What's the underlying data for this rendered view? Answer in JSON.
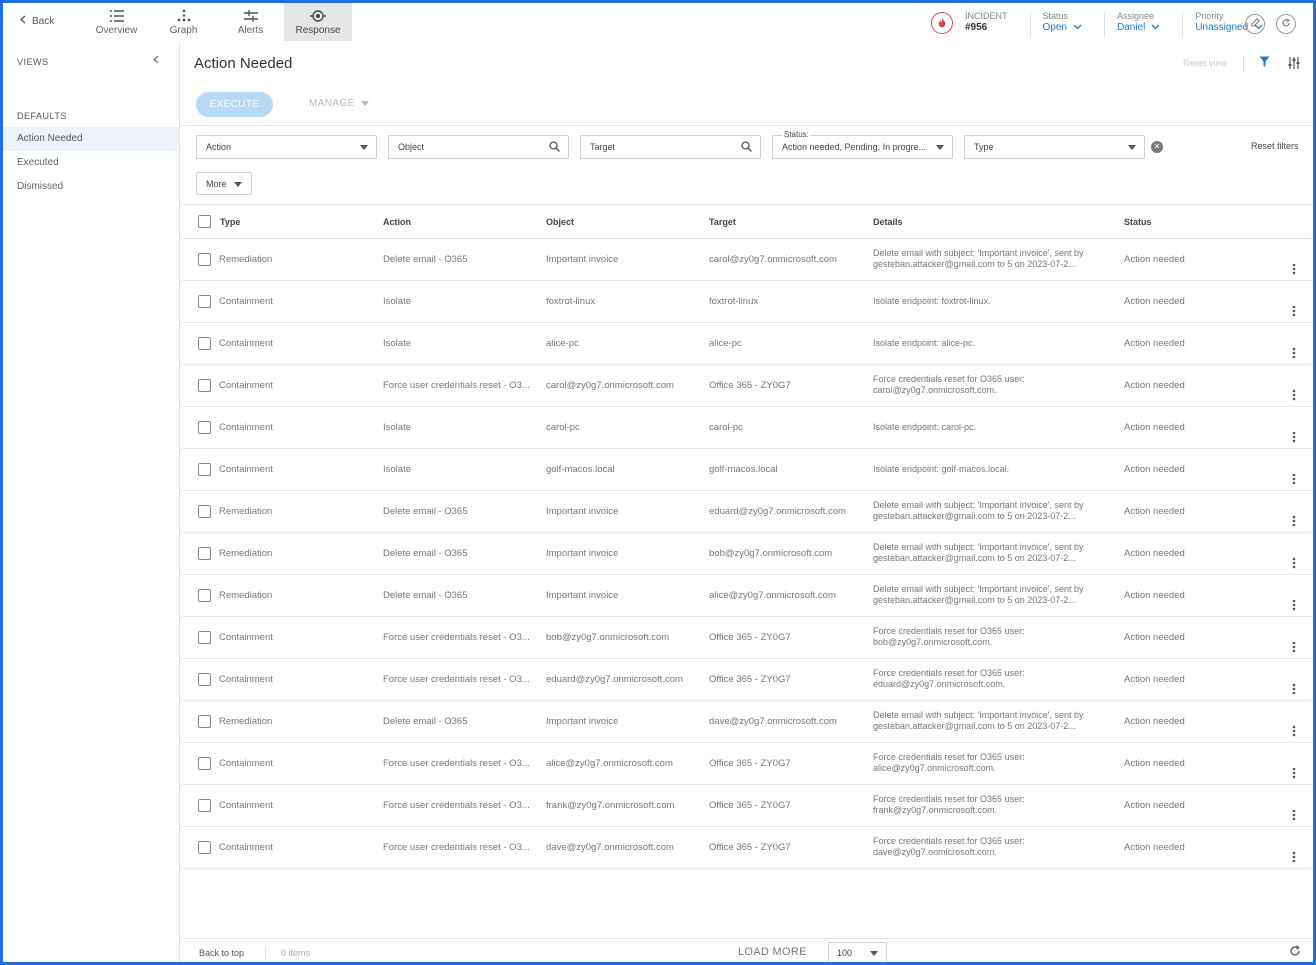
{
  "topbar": {
    "back_label": "Back",
    "tabs": [
      {
        "label": "Overview",
        "icon": "list-icon"
      },
      {
        "label": "Graph",
        "icon": "graph-icon"
      },
      {
        "label": "Alerts",
        "icon": "alerts-icon"
      },
      {
        "label": "Response",
        "icon": "response-icon"
      }
    ],
    "incident_label": "INCIDENT",
    "incident_id": "#956",
    "status_label": "Status",
    "status_value": "Open",
    "assignee_label": "Assignee",
    "assignee_value": "Daniel",
    "priority_label": "Priority",
    "priority_value": "Unassigned"
  },
  "sidebar": {
    "views_title": "VIEWS",
    "defaults_title": "DEFAULTS",
    "items": [
      "Action Needed",
      "Executed",
      "Dismissed"
    ]
  },
  "main": {
    "title": "Action Needed",
    "reset_view": "Reset view",
    "execute_label": "EXECUTE",
    "manage_label": "MANAGE",
    "filters": {
      "action": "Action",
      "object": "Object",
      "target": "Target",
      "status_label": "Status:",
      "status_value": "Action needed, Pending, In progre...",
      "type": "Type",
      "reset": "Reset filters",
      "more": "More"
    },
    "columns": [
      "Type",
      "Action",
      "Object",
      "Target",
      "Details",
      "Status"
    ],
    "rows": [
      {
        "type": "Remediation",
        "action": "Delete email - O365",
        "object": "Important invoice",
        "target": "carol@zy0g7.onmicrosoft.com",
        "details": "Delete email with subject: 'Important invoice', sent by gesteban.attacker@gmail.com to 5 on 2023-07-2...",
        "status": "Action needed"
      },
      {
        "type": "Containment",
        "action": "Isolate",
        "object": "foxtrot-linux",
        "target": "foxtrot-linux",
        "details": "Isolate endpoint: foxtrot-linux.",
        "status": "Action needed"
      },
      {
        "type": "Containment",
        "action": "Isolate",
        "object": "alice-pc",
        "target": "alice-pc",
        "details": "Isolate endpoint: alice-pc.",
        "status": "Action needed"
      },
      {
        "type": "Containment",
        "action": "Force user credentials reset - O3...",
        "object": "carol@zy0g7.onmicrosoft.com",
        "target": "Office 365 - ZY0G7",
        "details": "Force credentials reset for O365 user: carol@zy0g7.onmicrosoft.com.",
        "status": "Action needed"
      },
      {
        "type": "Containment",
        "action": "Isolate",
        "object": "carol-pc",
        "target": "carol-pc",
        "details": "Isolate endpoint: carol-pc.",
        "status": "Action needed"
      },
      {
        "type": "Containment",
        "action": "Isolate",
        "object": "golf-macos.local",
        "target": "golf-macos.local",
        "details": "Isolate endpoint: golf-macos.local.",
        "status": "Action needed"
      },
      {
        "type": "Remediation",
        "action": "Delete email - O365",
        "object": "Important invoice",
        "target": "eduard@zy0g7.onmicrosoft.com",
        "details": "Delete email with subject: 'Important invoice', sent by gesteban.attacker@gmail.com to 5 on 2023-07-2...",
        "status": "Action needed"
      },
      {
        "type": "Remediation",
        "action": "Delete email - O365",
        "object": "Important invoice",
        "target": "bob@zy0g7.onmicrosoft.com",
        "details": "Delete email with subject: 'Important invoice', sent by gesteban.attacker@gmail.com to 5 on 2023-07-2...",
        "status": "Action needed"
      },
      {
        "type": "Remediation",
        "action": "Delete email - O365",
        "object": "Important invoice",
        "target": "alice@zy0g7.onmicrosoft.com",
        "details": "Delete email with subject: 'Important invoice', sent by gesteban.attacker@gmail.com to 5 on 2023-07-2...",
        "status": "Action needed"
      },
      {
        "type": "Containment",
        "action": "Force user credentials reset - O3...",
        "object": "bob@zy0g7.onmicrosoft.com",
        "target": "Office 365 - ZY0G7",
        "details": "Force credentials reset for O365 user: bob@zy0g7.onmicrosoft.com.",
        "status": "Action needed"
      },
      {
        "type": "Containment",
        "action": "Force user credentials reset - O3...",
        "object": "eduard@zy0g7.onmicrosoft.com",
        "target": "Office 365 - ZY0G7",
        "details": "Force credentials reset for O365 user: eduard@zy0g7.onmicrosoft.com.",
        "status": "Action needed"
      },
      {
        "type": "Remediation",
        "action": "Delete email - O365",
        "object": "Important invoice",
        "target": "dave@zy0g7.onmicrosoft.com",
        "details": "Delete email with subject: 'Important invoice', sent by gesteban.attacker@gmail.com to 5 on 2023-07-2...",
        "status": "Action needed"
      },
      {
        "type": "Containment",
        "action": "Force user credentials reset - O3...",
        "object": "alice@zy0g7.onmicrosoft.com",
        "target": "Office 365 - ZY0G7",
        "details": "Force credentials reset for O365 user: alice@zy0g7.onmicrosoft.com.",
        "status": "Action needed"
      },
      {
        "type": "Containment",
        "action": "Force user credentials reset - O3...",
        "object": "frank@zy0g7.onmicrosoft.com",
        "target": "Office 365 - ZY0G7",
        "details": "Force credentials reset for O365 user: frank@zy0g7.onmicrosoft.com.",
        "status": "Action needed"
      },
      {
        "type": "Containment",
        "action": "Force user credentials reset - O3...",
        "object": "dave@zy0g7.onmicrosoft.com",
        "target": "Office 365 - ZY0G7",
        "details": "Force credentials reset for O365 user: dave@zy0g7.onmicrosoft.com.",
        "status": "Action needed"
      }
    ]
  },
  "footer": {
    "back_to_top": "Back to top",
    "items_count": "0 items",
    "load_more": "LOAD MORE",
    "page_size": "100"
  },
  "colors": {
    "accent": "#1f7ec9",
    "execute_bg": "#b8d8f5",
    "incident_red": "#dd4444",
    "frame_blue": "#1f6fe0"
  }
}
